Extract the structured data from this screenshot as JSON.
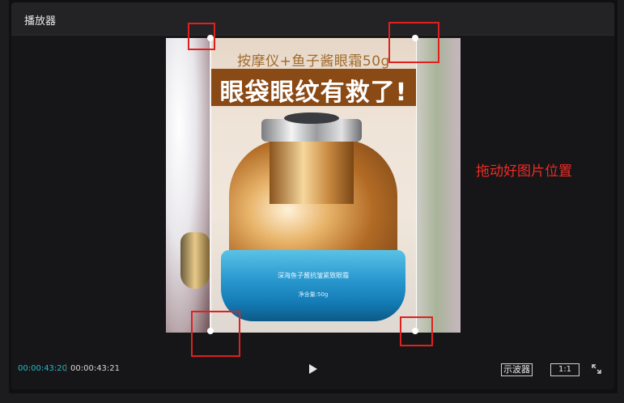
{
  "panel": {
    "title": "播放器"
  },
  "preview": {
    "top_caption": "按摩仪+鱼子酱眼霜50g",
    "banner_text": "眼袋眼纹有救了!",
    "jar_label": "深海鱼子酱抗皱紧致眼霜",
    "jar_weight": "净含量:50g"
  },
  "annotation": {
    "hint": "拖动好图片位置",
    "box_color": "#e0201f"
  },
  "controls": {
    "current_time": "00:00:43:20",
    "separator": "|",
    "total_time": "00:00:43:21",
    "scope_label": "示波器",
    "ratio_label": "1:1",
    "play_icon": "play-icon",
    "fullscreen_icon": "fullscreen-icon"
  },
  "colors": {
    "accent_time": "#23b8c7",
    "background": "#161618"
  }
}
